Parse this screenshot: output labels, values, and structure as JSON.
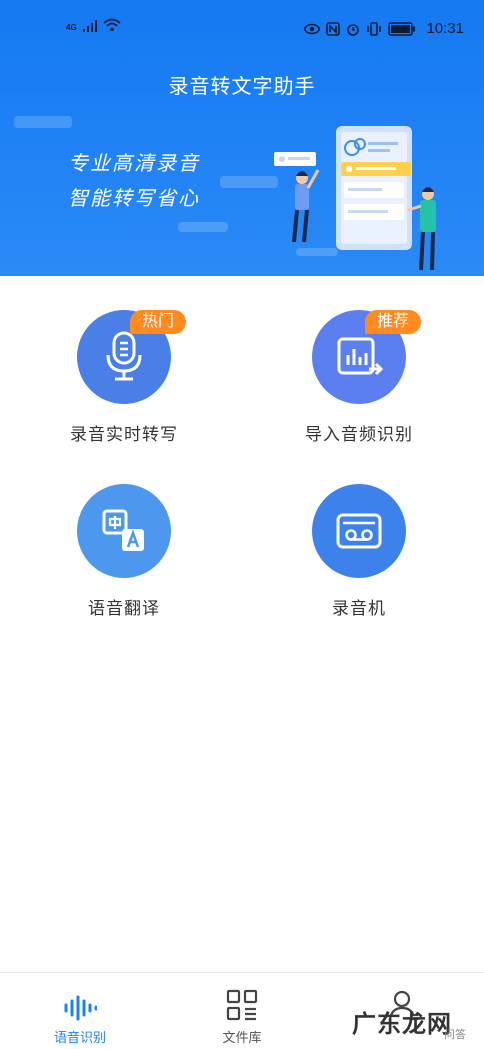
{
  "status_bar": {
    "network": "4G",
    "time": "10:31",
    "icons": [
      "signal-icon",
      "wifi-icon",
      "eye-icon",
      "nfc-icon",
      "alarm-icon",
      "vibrate-icon",
      "battery-icon"
    ]
  },
  "header": {
    "title": "录音转文字助手",
    "slogan_line1": "专业高清录音",
    "slogan_line2": "智能转写省心"
  },
  "features": [
    {
      "label": "录音实时转写",
      "badge": "热门",
      "icon": "microphone-icon",
      "color": "#4a7fe8"
    },
    {
      "label": "导入音频识别",
      "badge": "推荐",
      "icon": "audio-import-icon",
      "color": "#5b7ff0"
    },
    {
      "label": "语音翻译",
      "icon": "translate-icon",
      "color": "#4d97ee"
    },
    {
      "label": "录音机",
      "icon": "recorder-icon",
      "color": "#3d82ea"
    }
  ],
  "tabbar": {
    "tabs": [
      {
        "label": "语音识别",
        "icon": "waveform-icon",
        "active": true
      },
      {
        "label": "文件库",
        "icon": "file-library-icon",
        "active": false
      },
      {
        "label": "",
        "icon": "profile-icon",
        "active": false
      }
    ]
  },
  "watermark": {
    "text": "广东龙网",
    "sub": "问答"
  },
  "colors": {
    "header_blue": "#1479f2",
    "badge_orange": "#ff8a1f",
    "active_tab": "#1f7ff0"
  }
}
